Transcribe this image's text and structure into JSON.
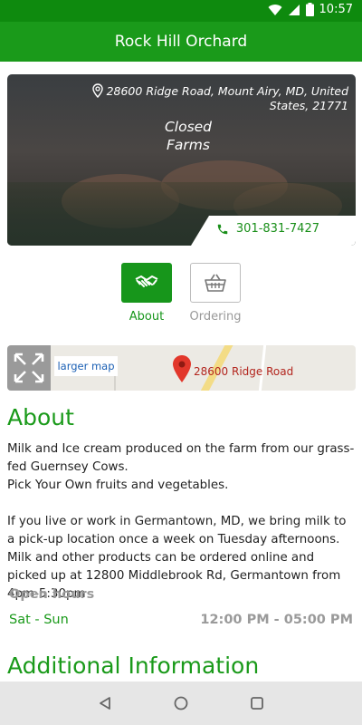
{
  "status_bar": {
    "time": "10:57",
    "icons": [
      "wifi-icon",
      "signal-icon",
      "battery-icon"
    ]
  },
  "app_bar": {
    "title": "Rock Hill Orchard"
  },
  "hero": {
    "address": "28600 Ridge Road, Mount Airy, MD, United States, 21771",
    "status": "Closed\nFarms",
    "phone": "301-831-7427"
  },
  "tabs": [
    {
      "label": "About",
      "icon": "handshake-icon",
      "active": true
    },
    {
      "label": "Ordering",
      "icon": "basket-icon",
      "active": false
    }
  ],
  "map": {
    "larger_map_link": "larger map",
    "pin_label": "28600 Ridge Road"
  },
  "about": {
    "title": "About",
    "text": "Milk and Ice cream produced on the farm from our grass-fed Guernsey Cows.\nPick Your Own fruits and vegetables.\n\nIf you live or work in Germantown, MD, we bring milk to a pick-up location once a week on Tuesday afternoons. Milk and other products can be ordered online and picked up at 12800 Middlebrook Rd, Germantown from 4pm-5:30pm",
    "hours_label": "Open hours",
    "hours_days": "Sat - Sun",
    "hours_time": "12:00 PM - 05:00 PM"
  },
  "additional": {
    "title": "Additional Information"
  },
  "colors": {
    "brand_green": "#1a9a1a",
    "status_green": "#0e8a0e",
    "link_blue": "#1a5fb4"
  }
}
